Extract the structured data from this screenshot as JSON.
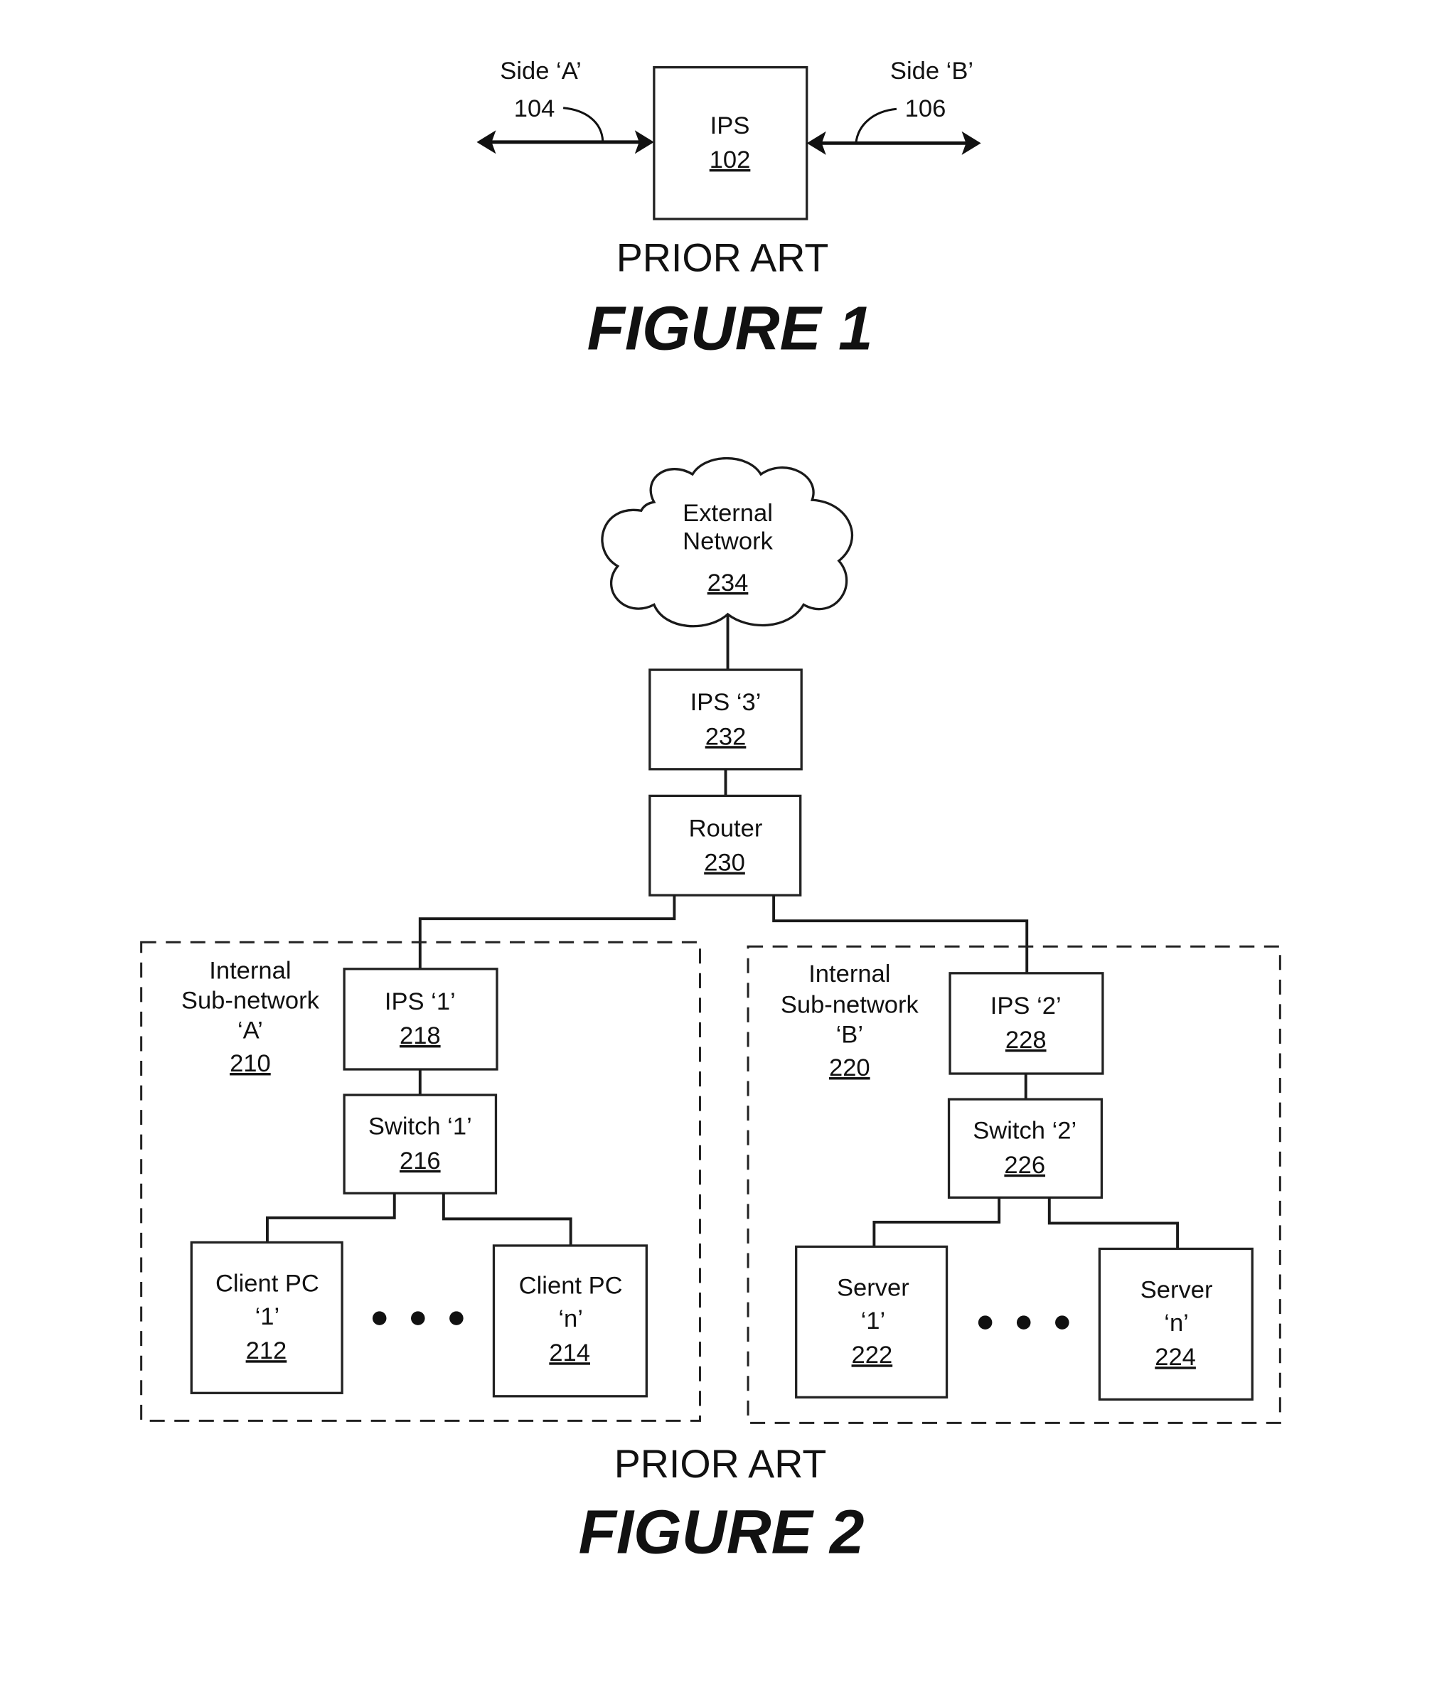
{
  "figure1": {
    "caption": "PRIOR ART",
    "title": "FIGURE 1",
    "ips": {
      "label": "IPS",
      "ref": "102"
    },
    "side_a": {
      "label": "Side ‘A’",
      "ref": "104"
    },
    "side_b": {
      "label": "Side ‘B’",
      "ref": "106"
    }
  },
  "figure2": {
    "caption": "PRIOR ART",
    "title": "FIGURE 2",
    "external_network": {
      "line1": "External",
      "line2": "Network",
      "ref": "234"
    },
    "ips3": {
      "label": "IPS ‘3’",
      "ref": "232"
    },
    "router": {
      "label": "Router",
      "ref": "230"
    },
    "subnet_a": {
      "line1": "Internal",
      "line2": "Sub-network",
      "line3": "‘A’",
      "ref": "210",
      "ips": {
        "label": "IPS ‘1’",
        "ref": "218"
      },
      "switch": {
        "label": "Switch ‘1’",
        "ref": "216"
      },
      "node_first": {
        "line1": "Client PC",
        "line2": "‘1’",
        "ref": "212"
      },
      "node_last": {
        "line1": "Client PC",
        "line2": "‘n’",
        "ref": "214"
      }
    },
    "subnet_b": {
      "line1": "Internal",
      "line2": "Sub-network",
      "line3": "‘B’",
      "ref": "220",
      "ips": {
        "label": "IPS ‘2’",
        "ref": "228"
      },
      "switch": {
        "label": "Switch ‘2’",
        "ref": "226"
      },
      "node_first": {
        "line1": "Server",
        "line2": "‘1’",
        "ref": "222"
      },
      "node_last": {
        "line1": "Server",
        "line2": "‘n’",
        "ref": "224"
      }
    }
  }
}
